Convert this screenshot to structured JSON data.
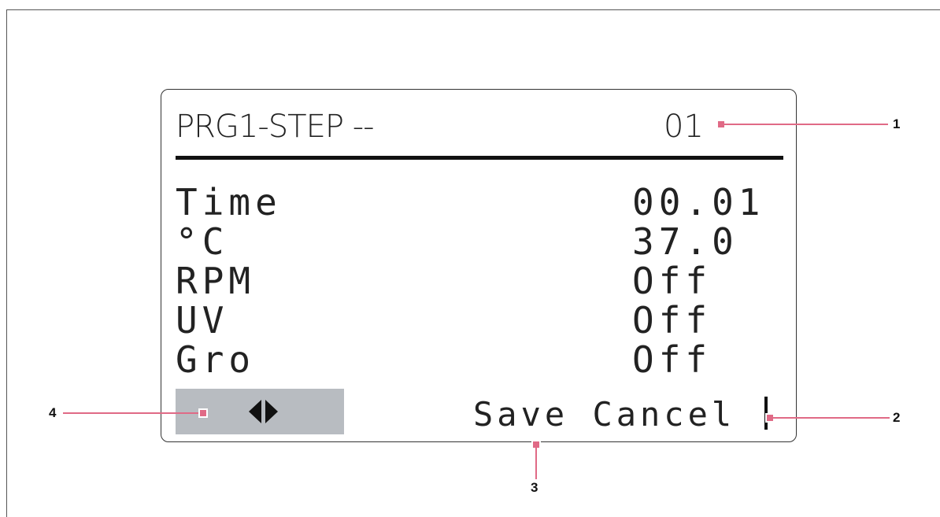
{
  "display": {
    "header": {
      "title": "PRG1-STEP --",
      "step": "01"
    },
    "rows": [
      {
        "label": "Time",
        "value": "00.01"
      },
      {
        "label": "°C",
        "value": "37.0"
      },
      {
        "label": "RPM",
        "value": "Off"
      },
      {
        "label": "UV",
        "value": "Off"
      },
      {
        "label": "Gro",
        "value": "Off"
      }
    ],
    "softkeys": {
      "save": "Save",
      "cancel": "Cancel"
    }
  },
  "callouts": [
    "1",
    "2",
    "3",
    "4"
  ],
  "colors": {
    "callout": "#e06a86",
    "nav_box": "#b8bcc1"
  },
  "icons": {
    "nav_left": "triangle-left-icon",
    "nav_right": "triangle-right-icon"
  }
}
